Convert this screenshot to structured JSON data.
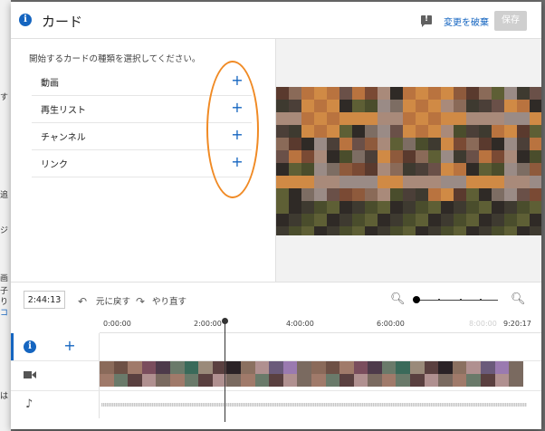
{
  "background": {
    "texts": [
      "す",
      "追",
      "ジ",
      "画",
      "子",
      "り",
      "コ",
      "は"
    ]
  },
  "dialog": {
    "title": "カード",
    "discard_label": "変更を破棄",
    "save_label": "保存",
    "accent": "#1565c0"
  },
  "card_picker": {
    "prompt": "開始するカードの種類を選択してください。",
    "items": [
      {
        "label": "動画",
        "icon": "+"
      },
      {
        "label": "再生リスト",
        "icon": "+"
      },
      {
        "label": "チャンネル",
        "icon": "+"
      },
      {
        "label": "リンク",
        "icon": "+"
      }
    ],
    "highlight_color": "#f08a24"
  },
  "timeline": {
    "timecode": "2:44:13",
    "undo_label": "元に戻す",
    "redo_label": "やり直す",
    "ruler": [
      "0:00:00",
      "2:00:00",
      "4:00:00",
      "6:00:00",
      "8:00:00",
      "9:20:17"
    ],
    "tracks": [
      {
        "name": "cards-track",
        "icon": "info-icon",
        "action_icon": "+"
      },
      {
        "name": "video-track",
        "icon": "video-camera-icon"
      },
      {
        "name": "audio-track",
        "icon": "music-note-icon"
      }
    ]
  }
}
